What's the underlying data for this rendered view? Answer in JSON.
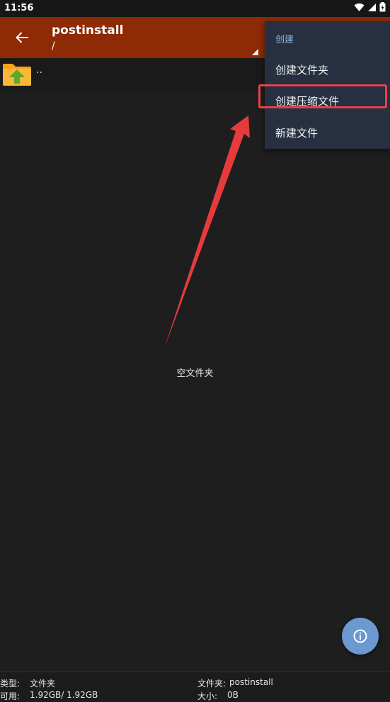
{
  "status_bar": {
    "time": "11:56"
  },
  "toolbar": {
    "title": "postinstall",
    "path": "/"
  },
  "file_list": {
    "parent_item": ".."
  },
  "empty_message": "空文件夹",
  "menu": {
    "header": "创建",
    "items": [
      {
        "label": "创建文件夹"
      },
      {
        "label": "创建压缩文件",
        "highlighted": true
      },
      {
        "label": "新建文件"
      }
    ]
  },
  "info_bar": {
    "type_label": "类型:",
    "type_value": "文件夹",
    "available_label": "可用:",
    "available_value": "1.92GB/ 1.92GB",
    "folder_label": "文件夹:",
    "folder_value": "postinstall",
    "size_label": "大小:",
    "size_value": "0B"
  },
  "colors": {
    "toolbar": "#8e2a06",
    "background": "#1e1e1e",
    "menu": "#263040",
    "highlight": "#e8414a",
    "fab": "#6b99d0"
  },
  "icons": [
    "wifi-icon",
    "signal-icon",
    "battery-icon",
    "back-arrow-icon",
    "folder-up-icon",
    "info-icon",
    "annotation-arrow"
  ]
}
